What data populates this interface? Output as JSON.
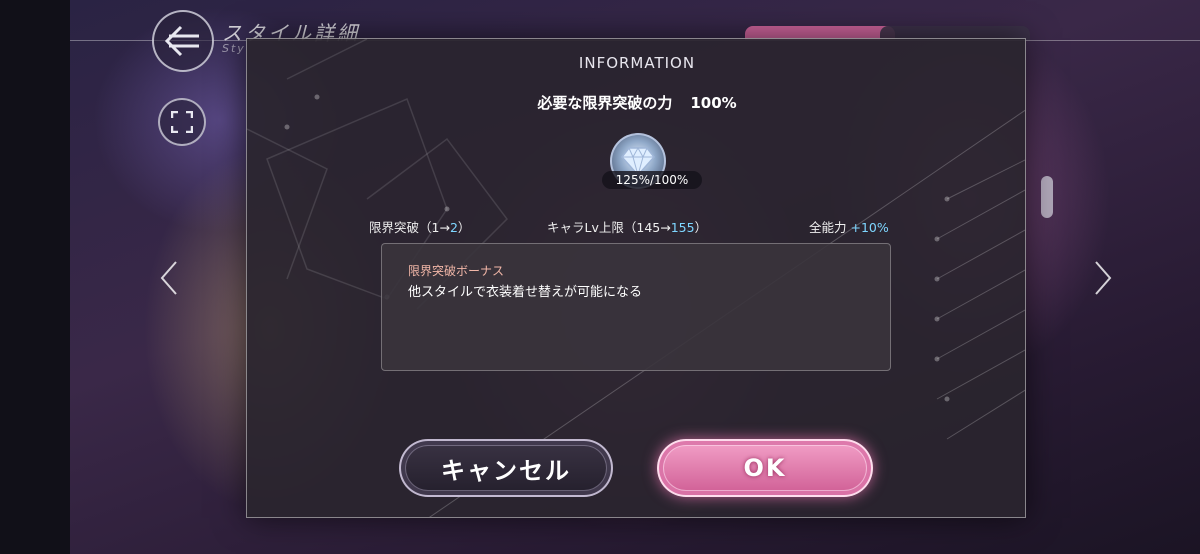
{
  "screen": {
    "title": "スタイル詳細",
    "subtitle": "Sty"
  },
  "dialog": {
    "title": "INFORMATION",
    "required_label": "必要な限界突破の力",
    "required_percent": "100%",
    "gem_count": "125%/100%",
    "stats": {
      "limit_break": {
        "label": "限界突破（1→",
        "value": "2",
        "suffix": "）"
      },
      "level_cap": {
        "label": "キャラLv上限（145→",
        "value": "155",
        "suffix": "）"
      },
      "all_stats": {
        "label": "全能力",
        "value": "+10%"
      }
    },
    "bonus": {
      "title": "限界突破ボーナス",
      "text": "他スタイルで衣装着せ替えが可能になる"
    },
    "buttons": {
      "cancel": "キャンセル",
      "ok": "OK"
    }
  },
  "colors": {
    "accent_pink": "#e86ea8",
    "highlight_blue": "#7ed6ff",
    "bonus_title": "#f2b7a8"
  },
  "icons": [
    "back-arrow-icon",
    "expand-icon",
    "chevron-left-icon",
    "chevron-right-icon",
    "crystal-gem-icon"
  ]
}
